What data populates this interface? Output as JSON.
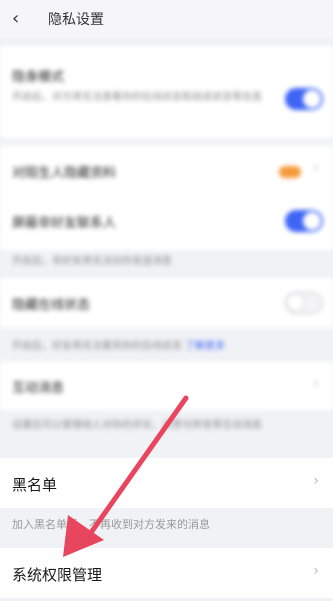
{
  "header": {
    "back_icon": "‹",
    "title": "隐私设置"
  },
  "sections": {
    "mode": {
      "label": "隐身模式",
      "desc": "开启后，对方将无法查看你的在线状态和阅读状态等信息",
      "enabled": true
    },
    "row2": {
      "label": "对陌生人隐藏资料",
      "badge": "new"
    },
    "row3": {
      "label": "屏蔽非好友联系人",
      "enabled": true
    },
    "row3_desc": "开启后，非好友将无法向你发送消息",
    "row4": {
      "label": "隐藏在线状态",
      "enabled": false
    },
    "row4_desc": "开启后，好友将无法看到你的在线状态",
    "row4_link": "了解更多",
    "row5": {
      "label": "互动消息"
    },
    "row5_desc": "设置后可以管理他人对你的评论、点赞与转发等互动消息"
  },
  "blacklist": {
    "label": "黑名单",
    "desc": "加入黑名单后，不再收到对方发来的消息"
  },
  "permissions": {
    "label": "系统权限管理"
  },
  "colors": {
    "accent": "#3d64f5",
    "arrow": "#e8455f"
  }
}
